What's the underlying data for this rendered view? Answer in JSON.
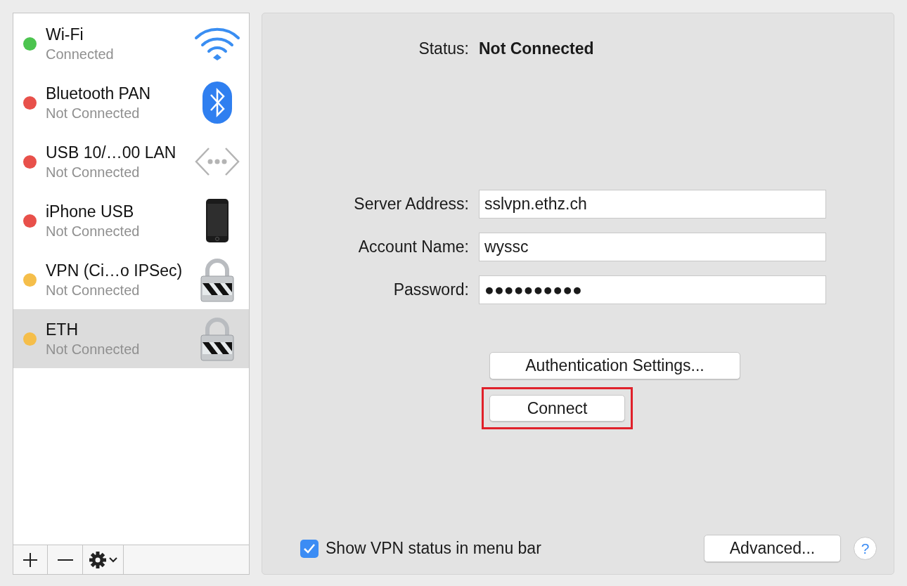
{
  "services": [
    {
      "name": "Wi-Fi",
      "status": "Connected",
      "color": "#4cc44f",
      "kind": "wifi",
      "selected": false
    },
    {
      "name": "Bluetooth PAN",
      "status": "Not Connected",
      "color": "#e8504a",
      "kind": "bluetooth",
      "selected": false
    },
    {
      "name": "USB 10/…00 LAN",
      "status": "Not Connected",
      "color": "#e8504a",
      "kind": "ethernet",
      "selected": false
    },
    {
      "name": "iPhone USB",
      "status": "Not Connected",
      "color": "#e8504a",
      "kind": "phone",
      "selected": false
    },
    {
      "name": "VPN (Ci…o IPSec)",
      "status": "Not Connected",
      "color": "#f5be4a",
      "kind": "vpn",
      "selected": false
    },
    {
      "name": "ETH",
      "status": "Not Connected",
      "color": "#f5be4a",
      "kind": "vpn",
      "selected": true
    }
  ],
  "detail": {
    "status_label": "Status:",
    "status_value": "Not Connected",
    "fields": [
      {
        "label": "Server Address:",
        "value": "sslvpn.ethz.ch"
      },
      {
        "label": "Account Name:",
        "value": "wyssc"
      },
      {
        "label": "Password:",
        "value": "●●●●●●●●●●"
      }
    ],
    "auth_button": "Authentication Settings...",
    "connect_button": {
      "label": "Connect",
      "highlighted": true
    },
    "show_status": {
      "label": "Show VPN status in menu bar",
      "checked": true
    },
    "advanced_button": "Advanced...",
    "help_button": "?"
  }
}
